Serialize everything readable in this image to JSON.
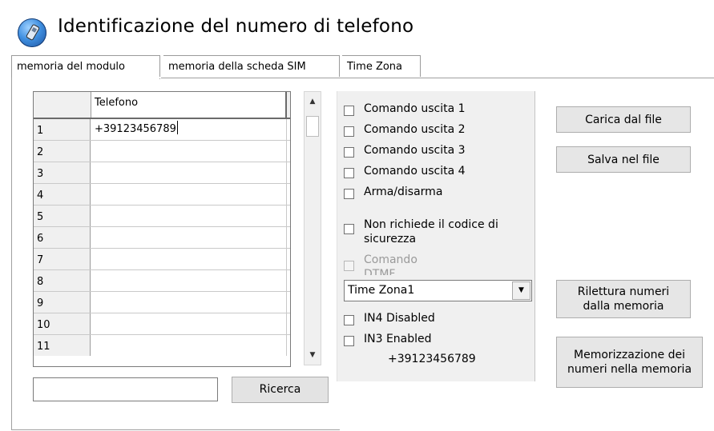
{
  "header": {
    "title": "Identificazione del numero di telefono",
    "icon": "phone-icon"
  },
  "tabs": [
    {
      "label": "memoria del modulo",
      "active": true
    },
    {
      "label": "memoria della scheda SIM",
      "active": false
    },
    {
      "label": "Time Zona",
      "active": false
    }
  ],
  "grid": {
    "column_header": "Telefono",
    "rows": [
      {
        "num": "1",
        "phone": "+39123456789"
      },
      {
        "num": "2",
        "phone": ""
      },
      {
        "num": "3",
        "phone": ""
      },
      {
        "num": "4",
        "phone": ""
      },
      {
        "num": "5",
        "phone": ""
      },
      {
        "num": "6",
        "phone": ""
      },
      {
        "num": "7",
        "phone": ""
      },
      {
        "num": "8",
        "phone": ""
      },
      {
        "num": "9",
        "phone": ""
      },
      {
        "num": "10",
        "phone": ""
      },
      {
        "num": "11",
        "phone": ""
      }
    ]
  },
  "search": {
    "value": "",
    "button_label": "Ricerca"
  },
  "options": {
    "comando_uscita_1": "Comando uscita 1",
    "comando_uscita_2": "Comando uscita 2",
    "comando_uscita_3": "Comando uscita 3",
    "comando_uscita_4": "Comando uscita 4",
    "arma_disarma": "Arma/disarma",
    "non_richiede_line1": "Non richiede il codice di",
    "non_richiede_line2": "sicurezza",
    "comando_dtmf_line1": "Comando",
    "comando_dtmf_line2": "DTMF",
    "time_zone_selected": "Time Zona1",
    "in4": "IN4 Disabled",
    "in3": "IN3 Enabled",
    "selected_number": "+39123456789"
  },
  "buttons": {
    "carica": "Carica dal file",
    "salva": "Salva nel file",
    "rilettura_line1": "Rilettura numeri",
    "rilettura_line2": "dalla memoria",
    "memorizzazione_line1": "Memorizzazione dei",
    "memorizzazione_line2": "numeri nella memoria"
  }
}
